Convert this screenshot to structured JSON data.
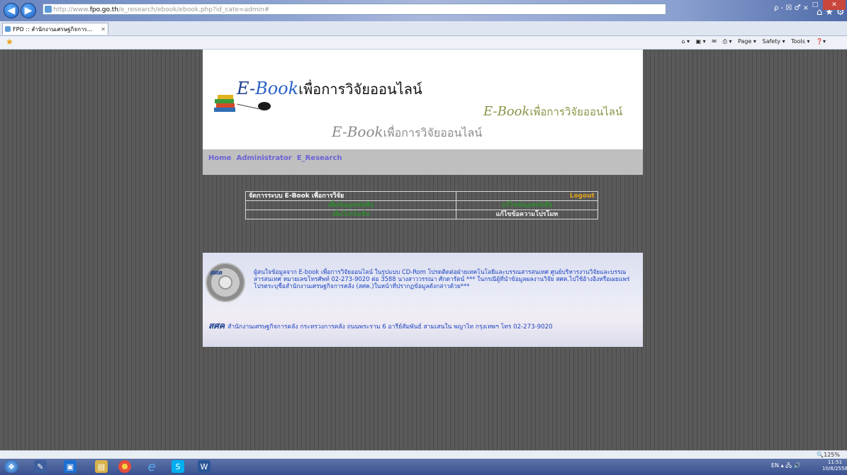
{
  "browser": {
    "url_prefix": "http://www.",
    "url_host": "fpo.go.th",
    "url_rest": "/e_research/ebook/ebook.php?id_cate=admin#",
    "address_controls": "ρ - ☒ ♂ ×",
    "tab_title": "FPO :: สำนักงานเศรษฐกิจการ...",
    "command_bar": [
      "Page ▾",
      "Safety ▾",
      "Tools ▾"
    ],
    "zoom": "🔍125%"
  },
  "banner": {
    "logo_en": "E-",
    "logo_book": "Book",
    "logo_th": "เพื่อการวิจัยออนไลน์"
  },
  "nav": [
    "Home",
    "Administrator",
    "E_Research"
  ],
  "admin": {
    "title": "จัดการระบบ E-Book เพื่อการวิจัย",
    "logout": "Logout",
    "cells": [
      [
        "เพิ่มข้อมูลหนังสือ",
        "แก้ไขข้อมูลหนังสือ"
      ],
      [
        "เพิ่มโปรโมชั่น",
        "แก้ไขข้อความโปรโมท"
      ]
    ]
  },
  "footer": {
    "cd_label": "สศค",
    "text": "ผู้สนใจข้อมูลจาก E-book เพื่อการวิจัยออนไลน์ ในรูปแบบ CD-Rom โปรดติดต่อฝ่ายเทคโนโลยีและบรรณสารสนเทศ ศูนย์บริหารงานวิจัยและบรรณสารสนเทศ หมายเลขโทรศัพท์ 02-273-9020 ต่อ 3588 นางสาววรรณา ศักดารัตน์ *** ในกรณีผู้ที่นำข้อมูลผลงานวิจัย สศค.ไปใช้อ้างอิงหรือเผยแพร่ โปรดระบุชื่อสำนักงานเศรษฐกิจการคลัง (สศค.)ในหน้าที่ปรากฏข้อมูลดังกล่าวด้วย***",
    "address": "สำนักงานเศรษฐกิจการคลัง กระทรวงการคลัง ถนนพระราม 6 อารีย์สัมพันธ์ สามเสนใน พญาไท กรุงเทพฯ โทร 02-273-9020"
  },
  "taskbar": {
    "tray": "EN ▴ 🖧 🔊",
    "time": "11:51",
    "date": "10/8/2558"
  }
}
